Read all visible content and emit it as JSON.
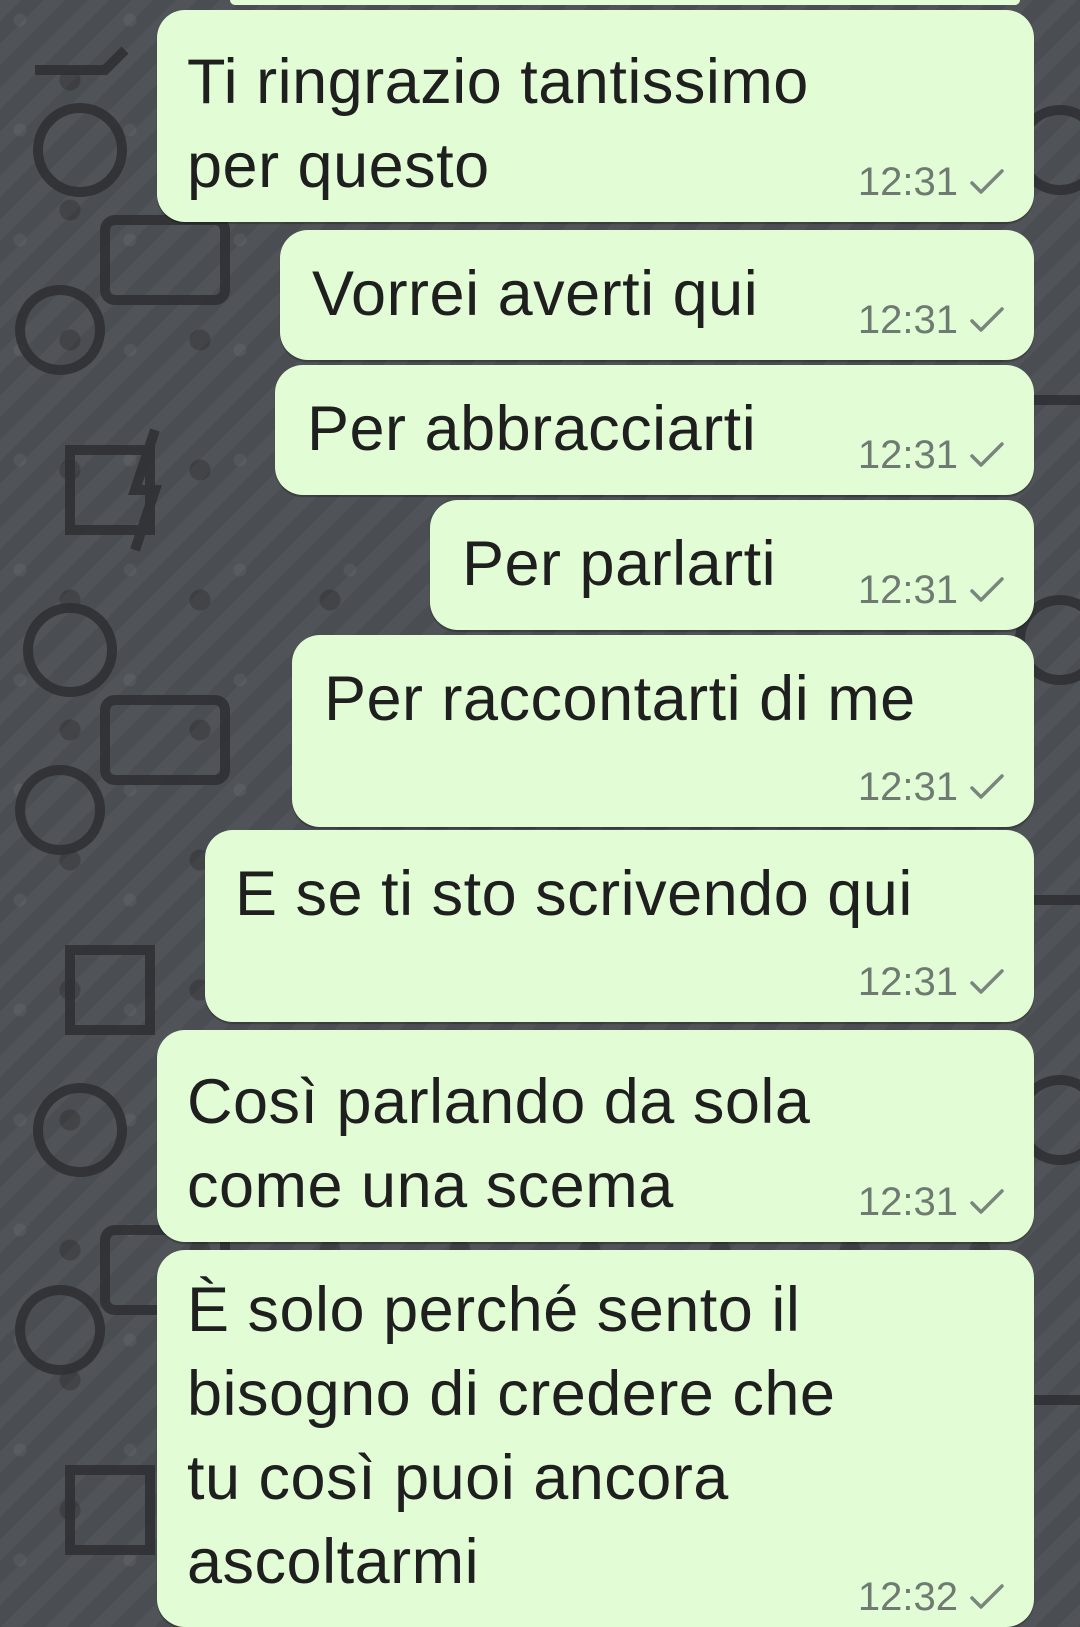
{
  "messages": [
    {
      "lines": "Ti ringrazio tantissimo\nper questo",
      "time": "12:31",
      "status": "sent-check-icon"
    },
    {
      "lines": "Vorrei averti qui",
      "time": "12:31",
      "status": "sent-check-icon"
    },
    {
      "lines": "Per abbracciarti",
      "time": "12:31",
      "status": "sent-check-icon"
    },
    {
      "lines": "Per parlarti",
      "time": "12:31",
      "status": "sent-check-icon"
    },
    {
      "lines": "Per raccontarti di me",
      "time": "12:31",
      "status": "sent-check-icon"
    },
    {
      "lines": "E se ti sto scrivendo qui",
      "time": "12:31",
      "status": "sent-check-icon"
    },
    {
      "lines": "Così parlando da sola\ncome una scema",
      "time": "12:31",
      "status": "sent-check-icon"
    },
    {
      "lines": "È solo perché sento il\nbisogno di credere che\ntu così puoi ancora\nascoltarmi",
      "time": "12:32",
      "status": "sent-check-icon"
    }
  ],
  "colors": {
    "bubble": "#e2fdd6",
    "wallpaper": "#4a4d52",
    "text": "#1f1f1f",
    "meta": "#6f7a72"
  }
}
